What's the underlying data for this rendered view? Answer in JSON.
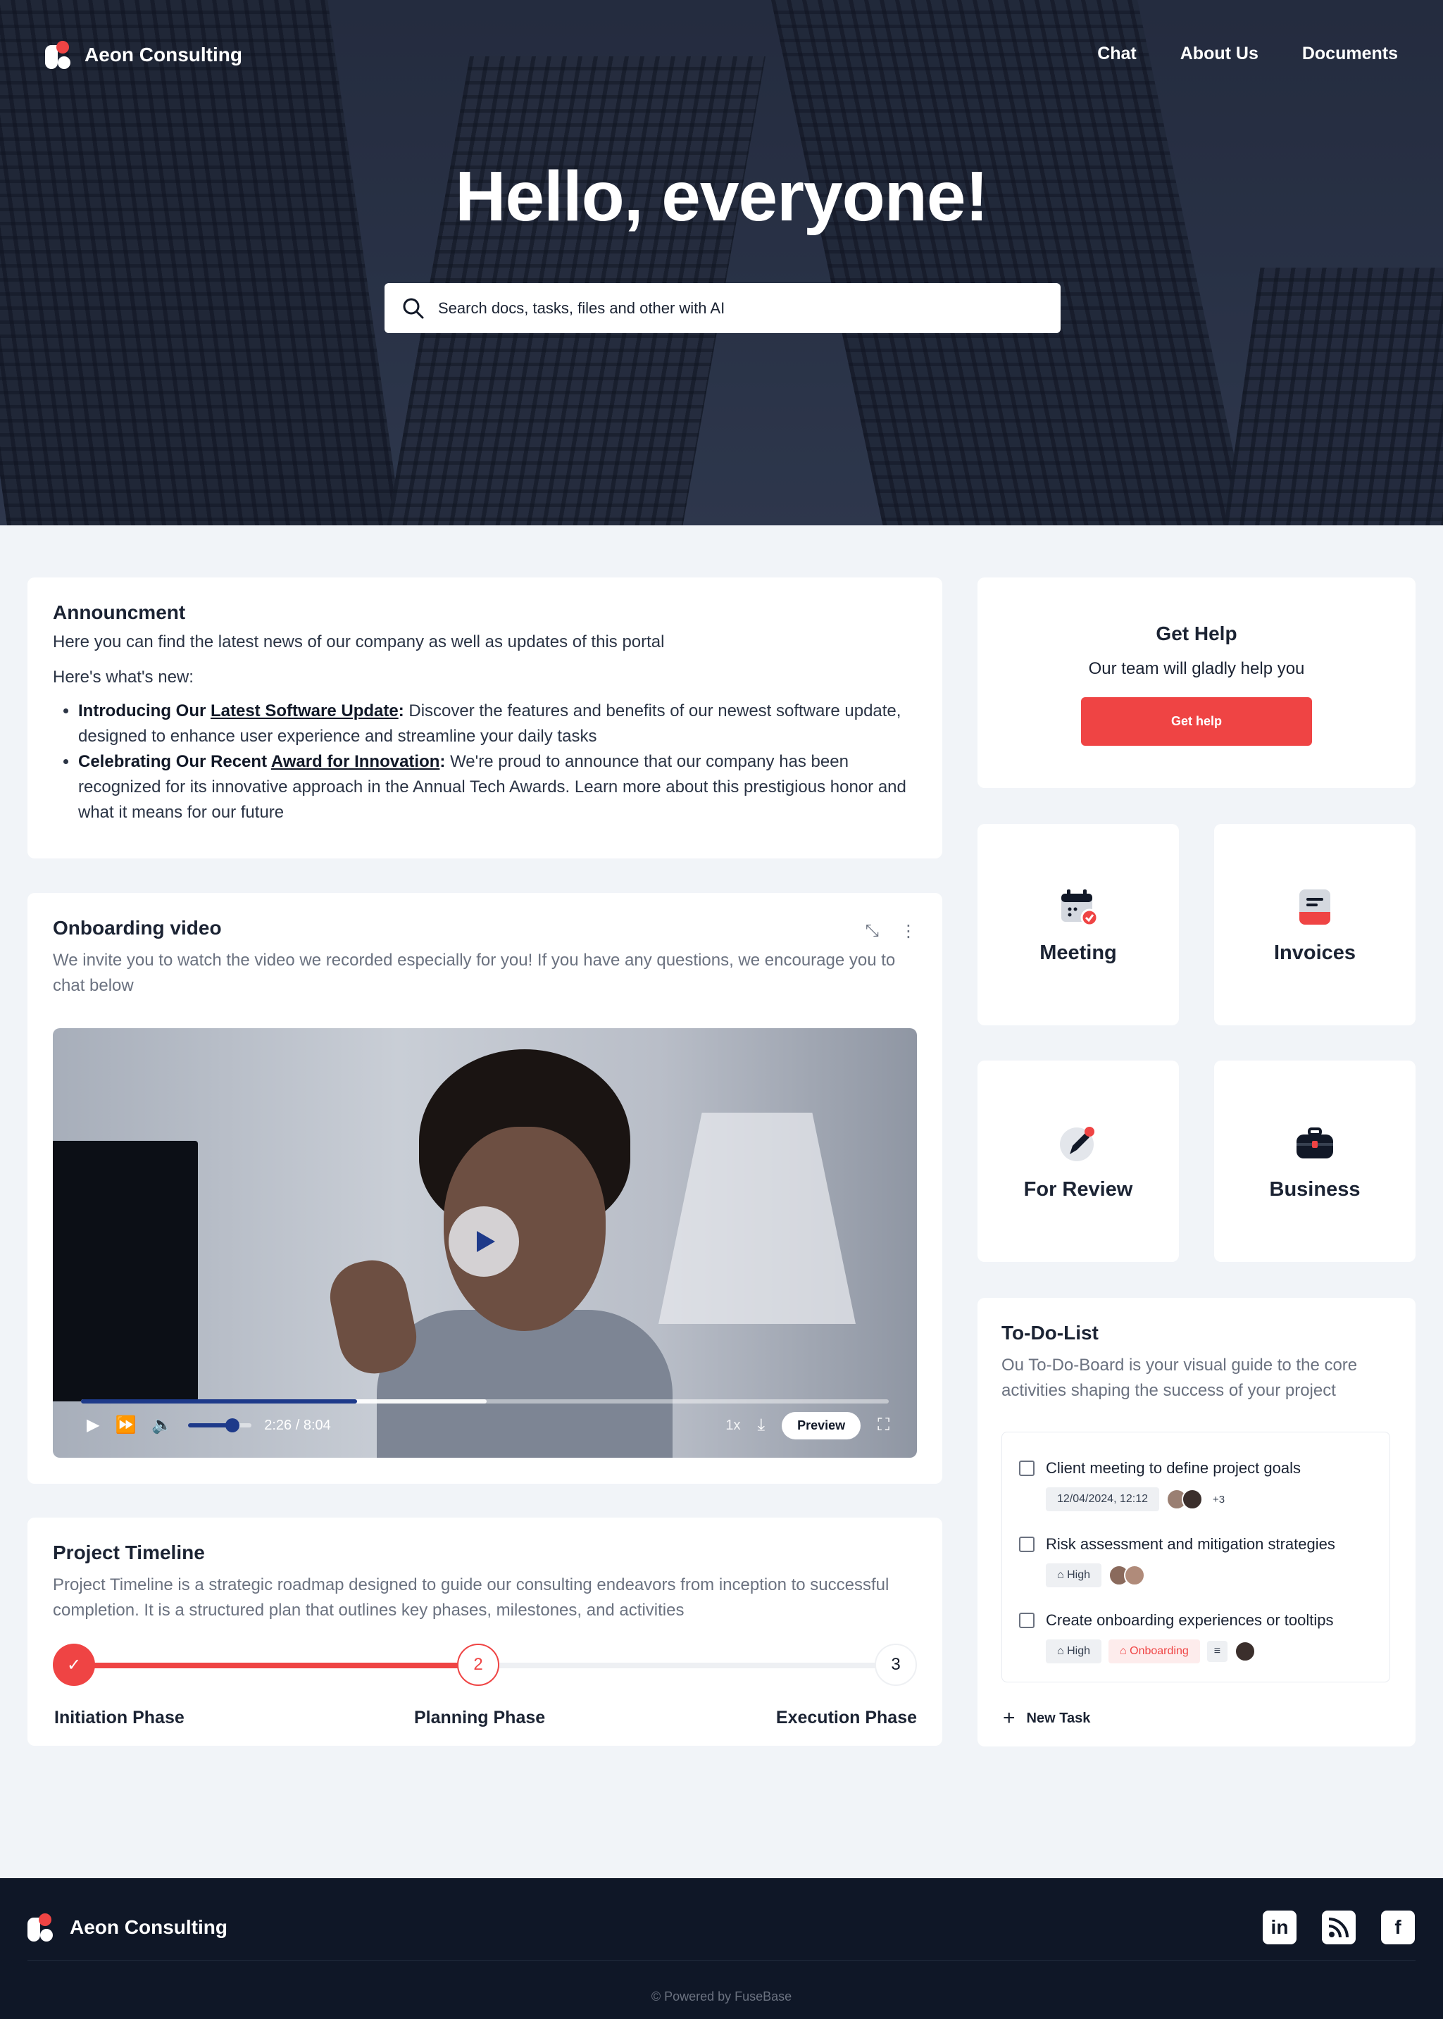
{
  "brand": {
    "name": "Aeon Consulting"
  },
  "nav": {
    "items": [
      "Chat",
      "About Us",
      "Documents"
    ]
  },
  "hero": {
    "title": "Hello, everyone!",
    "search_placeholder": "Search docs, tasks, files and other with AI"
  },
  "announcement": {
    "title": "Announcment",
    "intro": "Here you can find the latest news of our company as well as updates of this portal",
    "whats_new": "Here's what's new:",
    "items": [
      {
        "lead": "Introducing Our ",
        "link": "Latest Software Update",
        "colon": ":",
        "text": " Discover the features and benefits of our newest software update, designed to enhance user experience and streamline your daily tasks"
      },
      {
        "lead": "Celebrating Our Recent ",
        "link": "Award for Innovation",
        "colon": ":",
        "text": " We're proud to announce that our company has been recognized for its innovative approach in the Annual Tech Awards. Learn more about this prestigious honor and what it means for our future"
      }
    ]
  },
  "onboarding": {
    "title": "Onboarding video",
    "desc": "We invite you to watch the video we recorded especially for you! If you have any questions, we encourage you to chat below",
    "video": {
      "time": "2:26 / 8:04",
      "played_fraction": 0.342,
      "buffered_fraction": 0.502,
      "volume_fraction": 0.7,
      "speed": "1x",
      "preview_label": "Preview"
    }
  },
  "timeline": {
    "title": "Project Timeline",
    "desc": "Project Timeline is a strategic roadmap designed to guide our consulting endeavors from inception to successful completion. It is a structured plan that outlines key phases, milestones, and activities",
    "progress_fraction": 0.5,
    "steps": [
      {
        "label": "Initiation Phase",
        "marker": "✓",
        "state": "done"
      },
      {
        "label": "Planning Phase",
        "marker": "2",
        "state": "current"
      },
      {
        "label": "Execution Phase",
        "marker": "3",
        "state": "upcoming"
      }
    ]
  },
  "help": {
    "title": "Get Help",
    "subtitle": "Our team will gladly help you",
    "button": "Get help"
  },
  "tiles": [
    {
      "label": "Meeting",
      "icon": "calendar-check-icon"
    },
    {
      "label": "Invoices",
      "icon": "invoice-icon"
    },
    {
      "label": "For Review",
      "icon": "pen-icon"
    },
    {
      "label": "Business",
      "icon": "briefcase-icon"
    }
  ],
  "todo": {
    "title": "To-Do-List",
    "desc": "Ou To-Do-Board is your visual guide to the core activities shaping the success of your project",
    "tasks": [
      {
        "text": "Client meeting to define project goals",
        "date": "12/04/2024, 12:12",
        "extra": "+3"
      },
      {
        "text": "Risk assessment and mitigation strategies",
        "priority": "High"
      },
      {
        "text": "Create onboarding experiences or tooltips",
        "priority": "High",
        "tag": "Onboarding"
      }
    ],
    "new_task": "New Task"
  },
  "footer": {
    "brand": "Aeon Consulting",
    "powered": "© Powered by FuseBase",
    "social": [
      "linkedin-icon",
      "rss-icon",
      "facebook-icon"
    ]
  },
  "colors": {
    "accent": "#ef4444",
    "dark": "#0f1727",
    "video_progress": "#1e3a8a"
  }
}
